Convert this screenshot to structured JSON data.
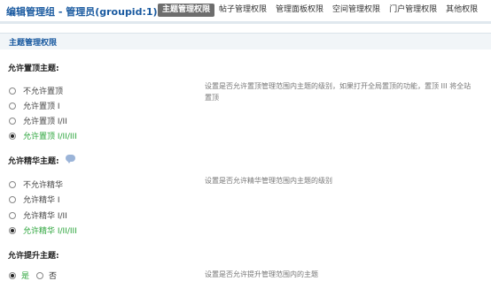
{
  "header": {
    "title": "编辑管理组 - 管理员(groupid:1)",
    "tabs": [
      "主题管理权限",
      "帖子管理权限",
      "管理面板权限",
      "空间管理权限",
      "门户管理权限",
      "其他权限"
    ],
    "active_tab": 0
  },
  "section": {
    "title": "主题管理权限"
  },
  "q1": {
    "label": "允许置顶主题:",
    "options": [
      "不允许置顶",
      "允许置顶 I",
      "允许置顶 I/II",
      "允许置顶 I/II/III"
    ],
    "selected": 3,
    "desc_line1": "设置是否允许置顶管理范围内主题的级别，如果打开全局置顶的功能，置顶 III 将全站",
    "desc_line2": "置顶"
  },
  "q2": {
    "label": "允许精华主题:",
    "options": [
      "不允许精华",
      "允许精华 I",
      "允许精华 I/II",
      "允许精华 I/II/III"
    ],
    "selected": 3,
    "desc": "设置是否允许精华管理范围内主题的级别"
  },
  "q3": {
    "label": "允许提升主题:",
    "options": [
      "是",
      "否"
    ],
    "selected": 0,
    "desc": "设置是否允许提升管理范围内的主题"
  }
}
